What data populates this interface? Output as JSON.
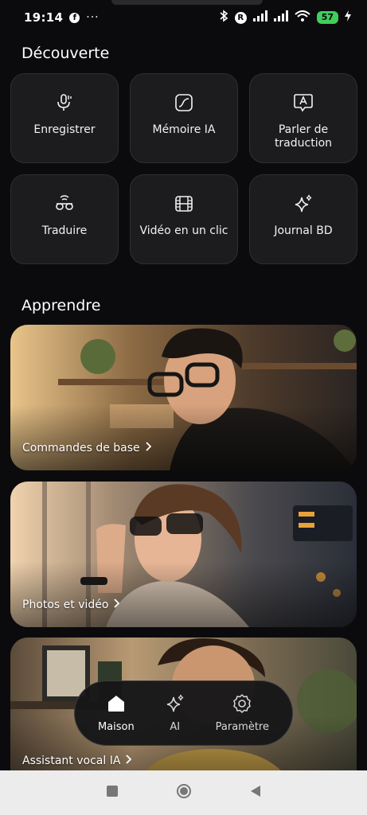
{
  "status_bar": {
    "time": "19:14",
    "facebook_glyph": "f",
    "more_glyph": "···",
    "r_glyph": "R",
    "battery": "57"
  },
  "sections": {
    "discover_title": "Découverte",
    "learn_title": "Apprendre"
  },
  "tiles": [
    {
      "label": "Enregistrer",
      "icon": "microphone-icon"
    },
    {
      "label": "Mémoire IA",
      "icon": "memory-icon"
    },
    {
      "label": "Parler de traduction",
      "icon": "translate-speech-icon"
    },
    {
      "label": "Traduire",
      "icon": "glasses-translate-icon"
    },
    {
      "label": "Vidéo en un clic",
      "icon": "film-icon"
    },
    {
      "label": "Journal BD",
      "icon": "sparkle-icon"
    }
  ],
  "learn_cards": [
    {
      "label": "Commandes de base"
    },
    {
      "label": "Photos et vidéo"
    },
    {
      "label": "Assistant vocal IA"
    }
  ],
  "bottom_nav": {
    "home": "Maison",
    "ai": "AI",
    "settings": "Paramètre",
    "active": "home"
  },
  "colors": {
    "background": "#0b0b0d",
    "tile": "#1c1c1f",
    "battery": "#3fcf5b"
  }
}
